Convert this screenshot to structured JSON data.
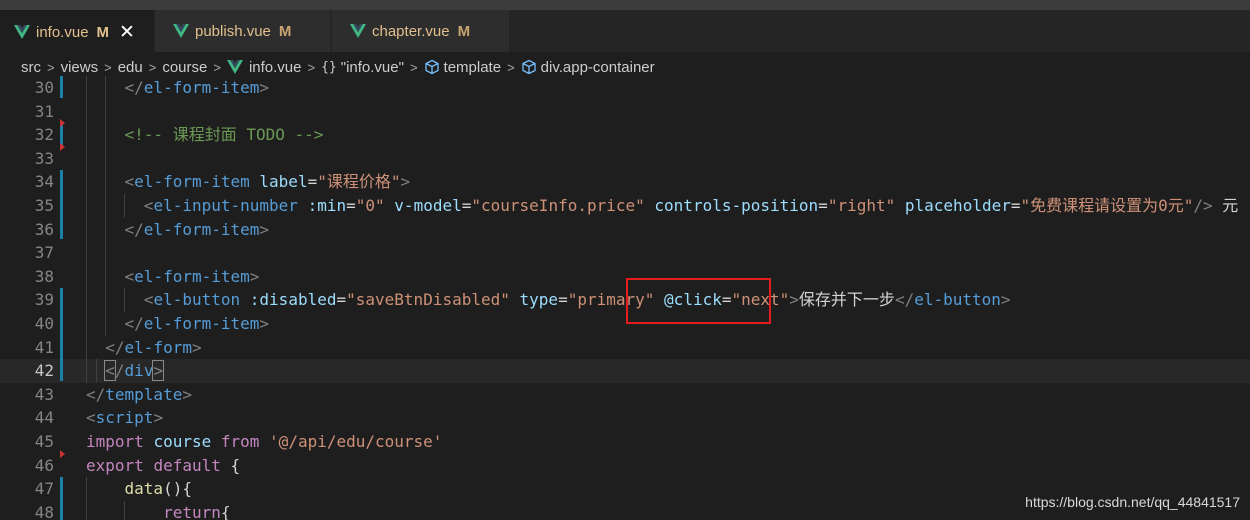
{
  "tabs": [
    {
      "label": "info.vue",
      "modified": "M",
      "active": true
    },
    {
      "label": "publish.vue",
      "modified": "M",
      "active": false
    },
    {
      "label": "chapter.vue",
      "modified": "M",
      "active": false
    }
  ],
  "tab_close_glyph": "✕",
  "breadcrumb": {
    "items": [
      "src",
      "views",
      "edu",
      "course",
      "info.vue",
      "\"info.vue\"",
      "template",
      "div.app-container"
    ],
    "braces": "{}"
  },
  "colors": {
    "vue_green": "#41b883",
    "modified": "#e2c08d",
    "highlight_box": "#e51c1c",
    "gutter_modified": "#1b81a8",
    "gutter_deleted": "#cc3333"
  },
  "editor": {
    "current_line": 42,
    "lines": [
      {
        "n": 30,
        "html": "    <span class=\"t-ang\">&lt;/</span><span class=\"t-tag\">el-form-item</span><span class=\"t-ang\">&gt;</span>"
      },
      {
        "n": 31,
        "html": ""
      },
      {
        "n": 32,
        "html": "    <span class=\"t-cmt\">&lt;!-- 课程封面 TODO --&gt;</span>"
      },
      {
        "n": 33,
        "html": ""
      },
      {
        "n": 34,
        "html": "    <span class=\"t-ang\">&lt;</span><span class=\"t-tag\">el-form-item</span> <span class=\"t-attr\">label</span><span class=\"t-txt\">=</span><span class=\"t-str\">\"课程价格\"</span><span class=\"t-ang\">&gt;</span>"
      },
      {
        "n": 35,
        "html": "      <span class=\"t-ang\">&lt;</span><span class=\"t-tag\">el-input-number</span> <span class=\"t-attr\">:min</span><span class=\"t-txt\">=</span><span class=\"t-str\">\"0\"</span> <span class=\"t-attr\">v-model</span><span class=\"t-txt\">=</span><span class=\"t-str\">\"courseInfo.price\"</span> <span class=\"t-attr\">controls-position</span><span class=\"t-txt\">=</span><span class=\"t-str\">\"right\"</span> <span class=\"t-attr\">placeholder</span><span class=\"t-txt\">=</span><span class=\"t-str\">\"免费课程请设置为0元\"</span><span class=\"t-ang\">/&gt;</span><span class=\"t-txt\"> 元</span>"
      },
      {
        "n": 36,
        "html": "    <span class=\"t-ang\">&lt;/</span><span class=\"t-tag\">el-form-item</span><span class=\"t-ang\">&gt;</span>"
      },
      {
        "n": 37,
        "html": ""
      },
      {
        "n": 38,
        "html": "    <span class=\"t-ang\">&lt;</span><span class=\"t-tag\">el-form-item</span><span class=\"t-ang\">&gt;</span>"
      },
      {
        "n": 39,
        "html": "      <span class=\"t-ang\">&lt;</span><span class=\"t-tag\">el-button</span> <span class=\"t-attr\">:disabled</span><span class=\"t-txt\">=</span><span class=\"t-str\">\"saveBtnDisabled\"</span> <span class=\"t-attr\">type</span><span class=\"t-txt\">=</span><span class=\"t-str\">\"primary\"</span> <span class=\"t-attr\">@click</span><span class=\"t-txt\">=</span><span class=\"t-str\">\"next\"</span><span class=\"t-ang\">&gt;</span><span class=\"t-txt\">保存并下一步</span><span class=\"t-ang\">&lt;/</span><span class=\"t-tag\">el-button</span><span class=\"t-ang\">&gt;</span>"
      },
      {
        "n": 40,
        "html": "    <span class=\"t-ang\">&lt;/</span><span class=\"t-tag\">el-form-item</span><span class=\"t-ang\">&gt;</span>"
      },
      {
        "n": 41,
        "html": "  <span class=\"t-ang\">&lt;/</span><span class=\"t-tag\">el-form</span><span class=\"t-ang\">&gt;</span>"
      },
      {
        "n": 42,
        "html": "  <span class=\"t-ang bracket-box\">&lt;</span><span class=\"t-ang\">/</span><span class=\"t-tag\">div</span><span class=\"t-ang bracket-box\">&gt;</span>"
      },
      {
        "n": 43,
        "html": "<span class=\"t-ang\">&lt;/</span><span class=\"t-tag\">template</span><span class=\"t-ang\">&gt;</span>"
      },
      {
        "n": 44,
        "html": "<span class=\"t-ang\">&lt;</span><span class=\"t-tag\">script</span><span class=\"t-ang\">&gt;</span>"
      },
      {
        "n": 45,
        "html": "<span class=\"t-kw\">import</span> <span class=\"t-var\">course</span> <span class=\"t-kw\">from</span> <span class=\"t-str\">'@/api/edu/course'</span>"
      },
      {
        "n": 46,
        "html": "<span class=\"t-kw\">export</span> <span class=\"t-kw\">default</span> <span class=\"t-txt\">{</span>"
      },
      {
        "n": 47,
        "html": "    <span class=\"t-fn\">data</span><span class=\"t-txt\">(){</span>"
      },
      {
        "n": 48,
        "html": "        <span class=\"t-kw\">return</span><span class=\"t-txt\">{</span>"
      }
    ]
  },
  "watermark": "https://blog.csdn.net/qq_44841517"
}
